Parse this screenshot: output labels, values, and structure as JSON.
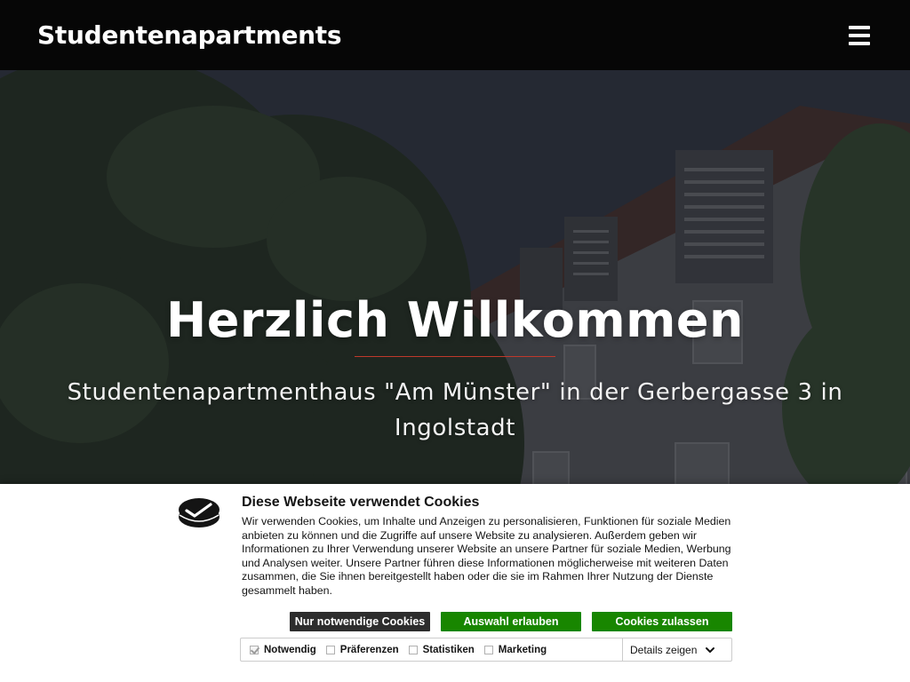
{
  "navbar": {
    "brand": "Studentenapartments",
    "menu_icon": "hamburger-menu-icon"
  },
  "hero": {
    "title": "Herzlich Willkommen",
    "subtitle": "Studentenapartmenthaus \"Am Münster\" in der Gerbergasse 3 in Ingolstadt",
    "background": "photo of apartment building with trees",
    "divider_color": "#c0392b"
  },
  "cookie_banner": {
    "logo_icon": "cookiebot-logo-icon",
    "title": "Diese Webseite verwendet Cookies",
    "text": "Wir verwenden Cookies, um Inhalte und Anzeigen zu personalisieren, Funktionen für soziale Medien anbieten zu können und die Zugriffe auf unsere Website zu analysieren. Außerdem geben wir Informationen zu Ihrer Verwendung unserer Website an unsere Partner für soziale Medien, Werbung und Analysen weiter. Unsere Partner führen diese Informationen möglicherweise mit weiteren Daten zusammen, die Sie ihnen bereitgestellt haben oder die sie im Rahmen Ihrer Nutzung der Dienste gesammelt haben.",
    "buttons": {
      "necessary_only": "Nur notwendige Cookies",
      "allow_selection": "Auswahl erlauben",
      "allow_all": "Cookies zulassen"
    },
    "options": [
      {
        "label": "Notwendig",
        "checked": true,
        "disabled": true
      },
      {
        "label": "Präferenzen",
        "checked": false
      },
      {
        "label": "Statistiken",
        "checked": false
      },
      {
        "label": "Marketing",
        "checked": false
      }
    ],
    "details_label": "Details zeigen",
    "colors": {
      "dark_button": "#2d2d2d",
      "accept_button": "#188600"
    }
  }
}
